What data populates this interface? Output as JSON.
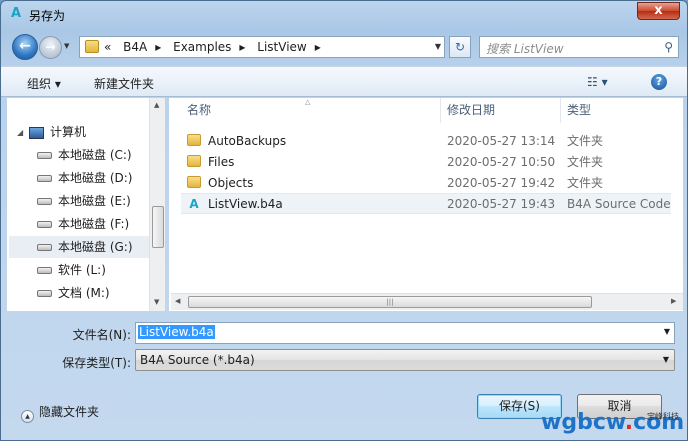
{
  "window": {
    "title": "另存为",
    "close_label": "x"
  },
  "nav": {
    "crumbs": [
      "«",
      "B4A",
      "Examples",
      "ListView"
    ],
    "search_placeholder": "搜索 ListView"
  },
  "toolbar": {
    "organize": "组织 ▾",
    "new_folder": "新建文件夹"
  },
  "tree": {
    "computer": "计算机",
    "drives": [
      {
        "label": "本地磁盘 (C:)",
        "selected": false
      },
      {
        "label": "本地磁盘 (D:)",
        "selected": false
      },
      {
        "label": "本地磁盘 (E:)",
        "selected": false
      },
      {
        "label": "本地磁盘 (F:)",
        "selected": false
      },
      {
        "label": "本地磁盘 (G:)",
        "selected": true
      },
      {
        "label": "软件 (L:)",
        "selected": false
      },
      {
        "label": "文档 (M:)",
        "selected": false
      }
    ]
  },
  "files": {
    "columns": {
      "name": "名称",
      "date": "修改日期",
      "type": "类型"
    },
    "rows": [
      {
        "name": "AutoBackups",
        "date": "2020-05-27 13:14",
        "type": "文件夹",
        "icon": "folder-icon"
      },
      {
        "name": "Files",
        "date": "2020-05-27 10:50",
        "type": "文件夹",
        "icon": "folder-icon"
      },
      {
        "name": "Objects",
        "date": "2020-05-27 19:42",
        "type": "文件夹",
        "icon": "folder-icon"
      },
      {
        "name": "ListView.b4a",
        "date": "2020-05-27 19:43",
        "type": "B4A Source Code",
        "icon": "b4a-icon"
      }
    ]
  },
  "form": {
    "filename_label": "文件名(N):",
    "filename_value": "ListView.b4a",
    "filetype_label": "保存类型(T):",
    "filetype_value": "B4A Source (*.b4a)",
    "hide_folders": "隐藏文件夹",
    "save": "保存(S)",
    "cancel": "取消"
  },
  "watermark": {
    "text_blue_1": "wgbcw",
    "text_red": ".",
    "text_blue_2": "com",
    "small": "宝峰科技"
  }
}
